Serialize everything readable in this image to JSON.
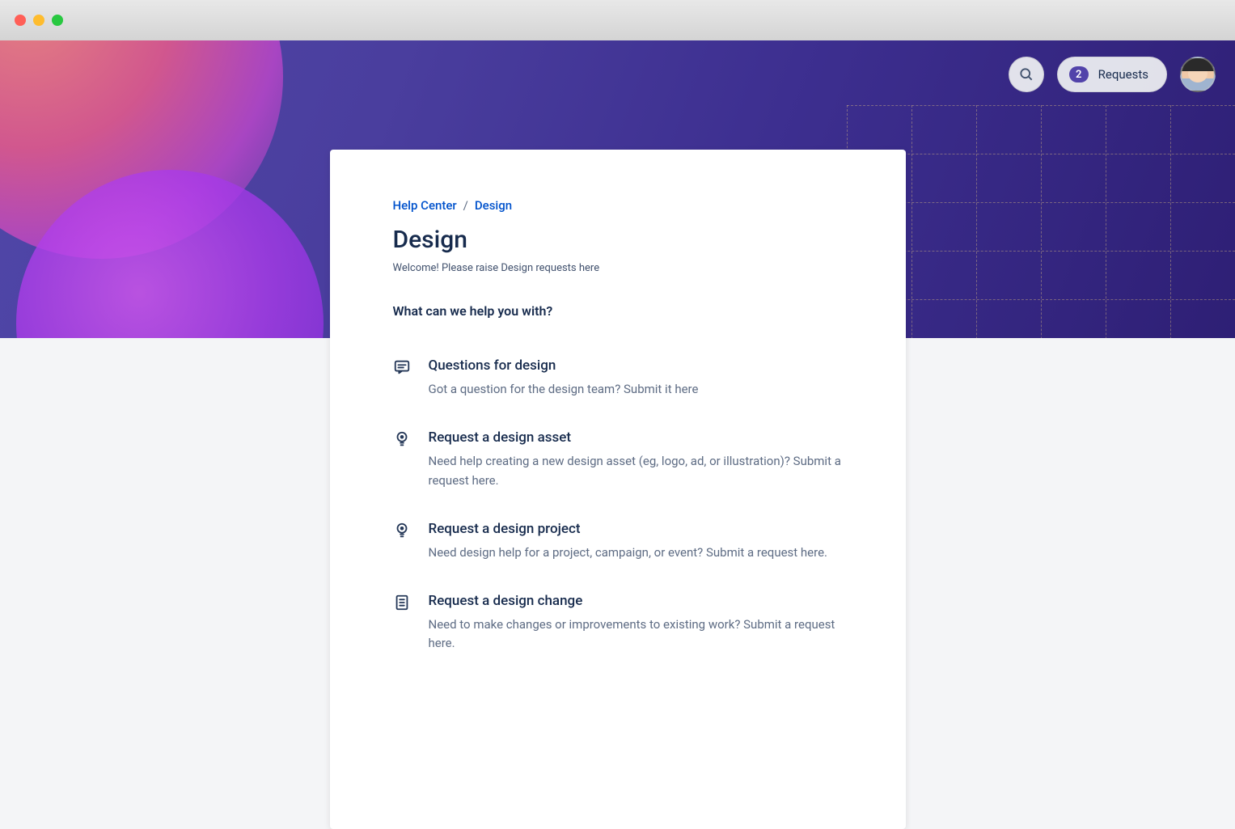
{
  "header": {
    "requests_count": "2",
    "requests_label": "Requests"
  },
  "breadcrumb": {
    "root": "Help Center",
    "current": "Design"
  },
  "page": {
    "title": "Design",
    "subtitle": "Welcome! Please raise Design requests here",
    "section_heading": "What can we help you with?"
  },
  "requests": [
    {
      "icon": "chat",
      "title": "Questions for design",
      "desc": "Got a question for the design team? Submit it here"
    },
    {
      "icon": "bulb",
      "title": "Request a design asset",
      "desc": "Need help creating a new design asset (eg, logo, ad, or illustration)? Submit a request here."
    },
    {
      "icon": "bulb",
      "title": "Request a design project",
      "desc": "Need design help for a project, campaign, or event? Submit a request here."
    },
    {
      "icon": "document",
      "title": "Request a design change",
      "desc": "Need to make changes or improvements to existing work? Submit a request here."
    }
  ]
}
